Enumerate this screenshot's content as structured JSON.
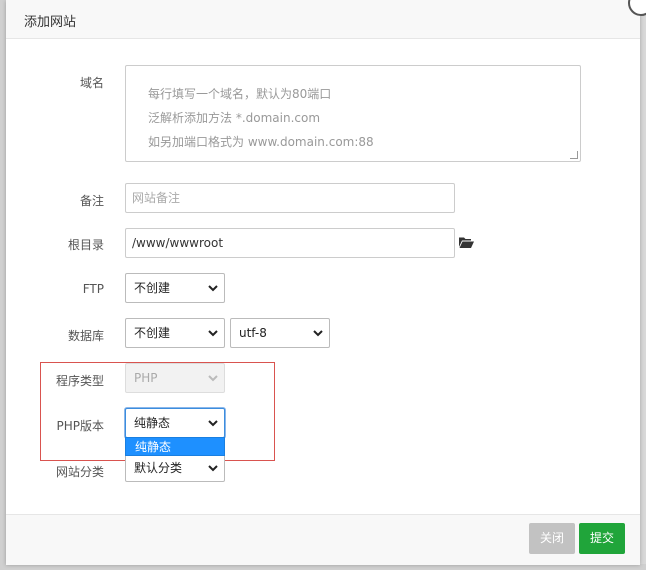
{
  "dialog": {
    "title": "添加网站"
  },
  "form": {
    "domain": {
      "label": "域名",
      "placeholder_lines": [
        "每行填写一个域名，默认为80端口",
        "泛解析添加方法 *.domain.com",
        "如另加端口格式为 www.domain.com:88"
      ]
    },
    "note": {
      "label": "备注",
      "placeholder": "网站备注"
    },
    "root": {
      "label": "根目录",
      "value": "/www/wwwroot",
      "icon": "folder-open-icon"
    },
    "ftp": {
      "label": "FTP",
      "selected": "不创建"
    },
    "database": {
      "label": "数据库",
      "selected": "不创建",
      "charset": "utf-8"
    },
    "program_type": {
      "label": "程序类型",
      "selected": "PHP"
    },
    "php_version": {
      "label": "PHP版本",
      "selected": "纯静态",
      "dropdown_option": "纯静态"
    },
    "category": {
      "label": "网站分类",
      "selected": "默认分类"
    }
  },
  "buttons": {
    "close": "关闭",
    "submit": "提交"
  },
  "colors": {
    "submit": "#20a53a",
    "close": "#c2c2c2",
    "highlight_box": "#d9534f",
    "dropdown_selected": "#1e90ff"
  }
}
